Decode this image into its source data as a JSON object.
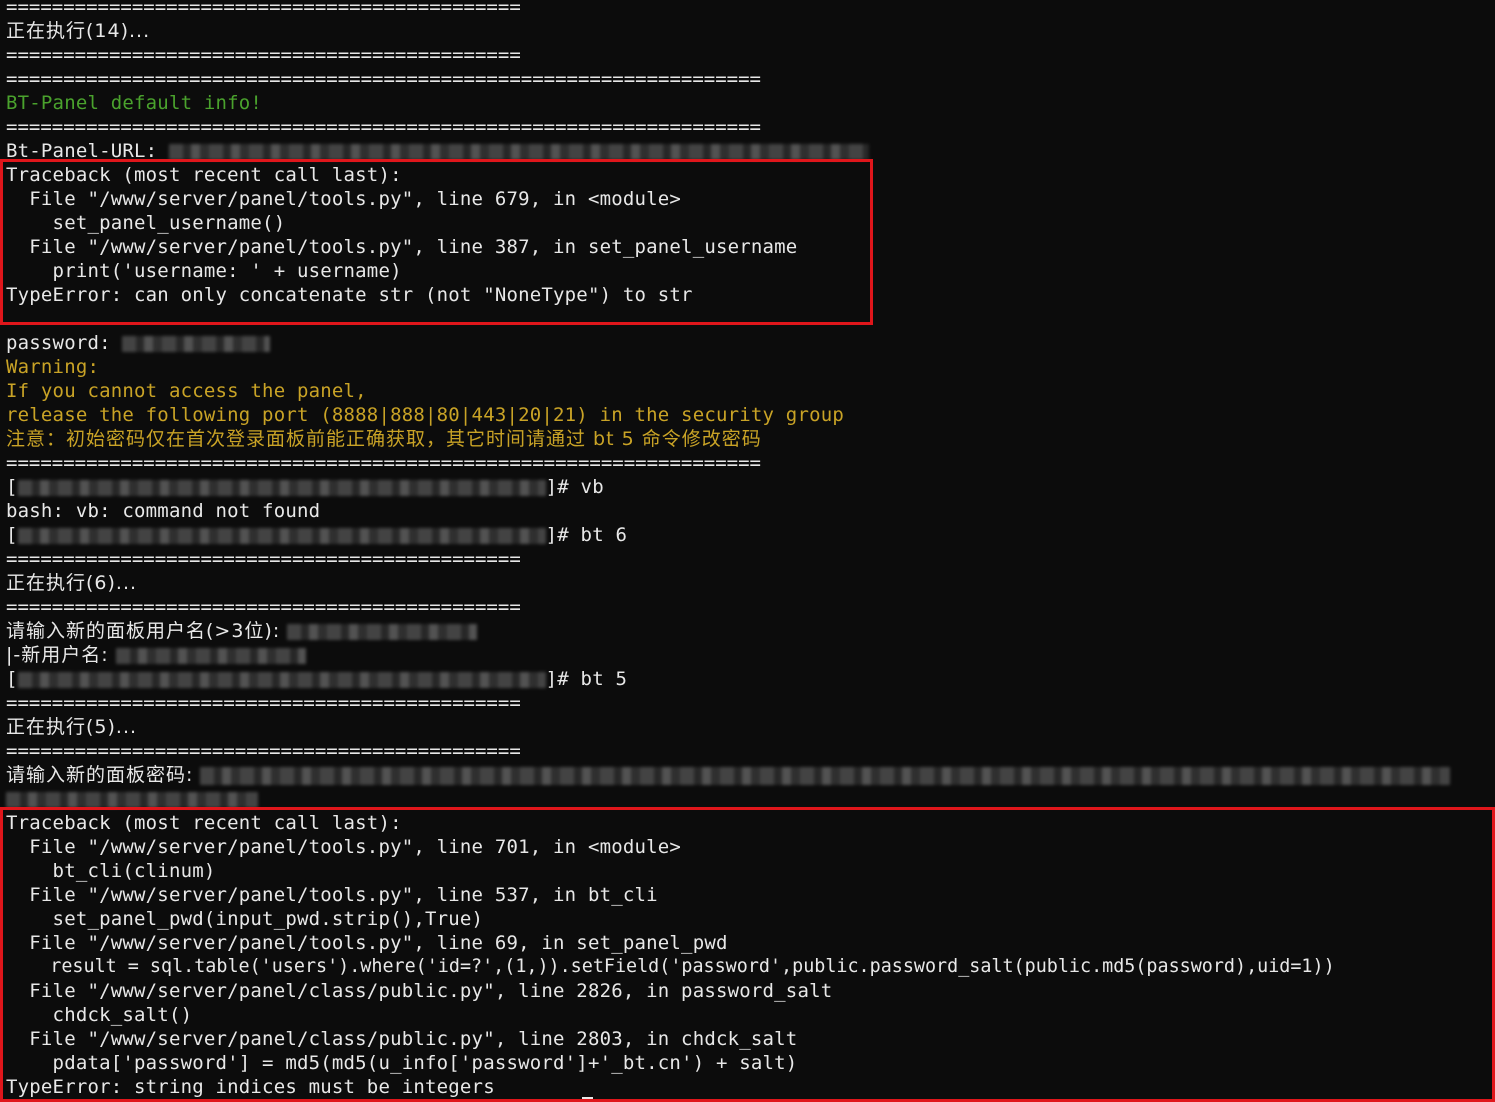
{
  "colors": {
    "background": "#0c0c0c",
    "text": "#e8e8e8",
    "info_green": "#4aa22d",
    "warning_yellow": "#c9a326",
    "highlight_red": "#e0161b"
  },
  "lines": {
    "sep_short_1": "=============================================",
    "exec14": "正在执行(14)...",
    "sep_short_2": "=============================================",
    "sep_long_1": "==================================================================",
    "bt_info": "BT-Panel default info!",
    "sep_long_2": "==================================================================",
    "url_label": "Bt-Panel-URL: ",
    "tb1_head": "Traceback (most recent call last):",
    "tb1_l1": "  File \"/www/server/panel/tools.py\", line 679, in <module>",
    "tb1_l2": "    set_panel_username()",
    "tb1_l3": "  File \"/www/server/panel/tools.py\", line 387, in set_panel_username",
    "tb1_l4": "    print('username: ' + username)",
    "tb1_err": "TypeError: can only concatenate str (not \"NoneType\") to str",
    "password_label": "password: ",
    "warning": "Warning:",
    "warn1": "If you cannot access the panel,",
    "warn2": "release the following port (8888|888|80|443|20|21) in the security group",
    "warn_cn": "注意：初始密码仅在首次登录面板前能正确获取，其它时间请通过 bt 5 命令修改密码",
    "sep_long_3": "==================================================================",
    "prompt1_open": "[",
    "prompt1_cmd": "]# vb",
    "bash_err": "bash: vb: command not found",
    "prompt2_open": "[",
    "prompt2_cmd": "]# bt 6",
    "sep_short_3": "=============================================",
    "exec6": "正在执行(6)...",
    "sep_short_4": "=============================================",
    "new_user_prompt": "请输入新的面板用户名(>3位): ",
    "new_user_done": "|-新用户名: ",
    "prompt3_open": "[",
    "prompt3_cmd": "]# bt 5",
    "sep_short_5": "=============================================",
    "exec5": "正在执行(5)...",
    "sep_short_6": "=============================================",
    "new_pwd_prompt": "请输入新的面板密码: ",
    "tb2_head": "Traceback (most recent call last):",
    "tb2_l1": "  File \"/www/server/panel/tools.py\", line 701, in <module>",
    "tb2_l2": "    bt_cli(clinum)",
    "tb2_l3": "  File \"/www/server/panel/tools.py\", line 537, in bt_cli",
    "tb2_l4": "    set_panel_pwd(input_pwd.strip(),True)",
    "tb2_l5": "  File \"/www/server/panel/tools.py\", line 69, in set_panel_pwd",
    "tb2_l6": "    result = sql.table('users').where('id=?',(1,)).setField('password',public.password_salt(public.md5(password),uid=1))",
    "tb2_l7": "  File \"/www/server/panel/class/public.py\", line 2826, in password_salt",
    "tb2_l8": "    chdck_salt()",
    "tb2_l9": "  File \"/www/server/panel/class/public.py\", line 2803, in chdck_salt",
    "tb2_l10": "    pdata['password'] = md5(md5(u_info['password']+'_bt.cn') + salt)",
    "tb2_err": "TypeError: string indices must be integers"
  }
}
